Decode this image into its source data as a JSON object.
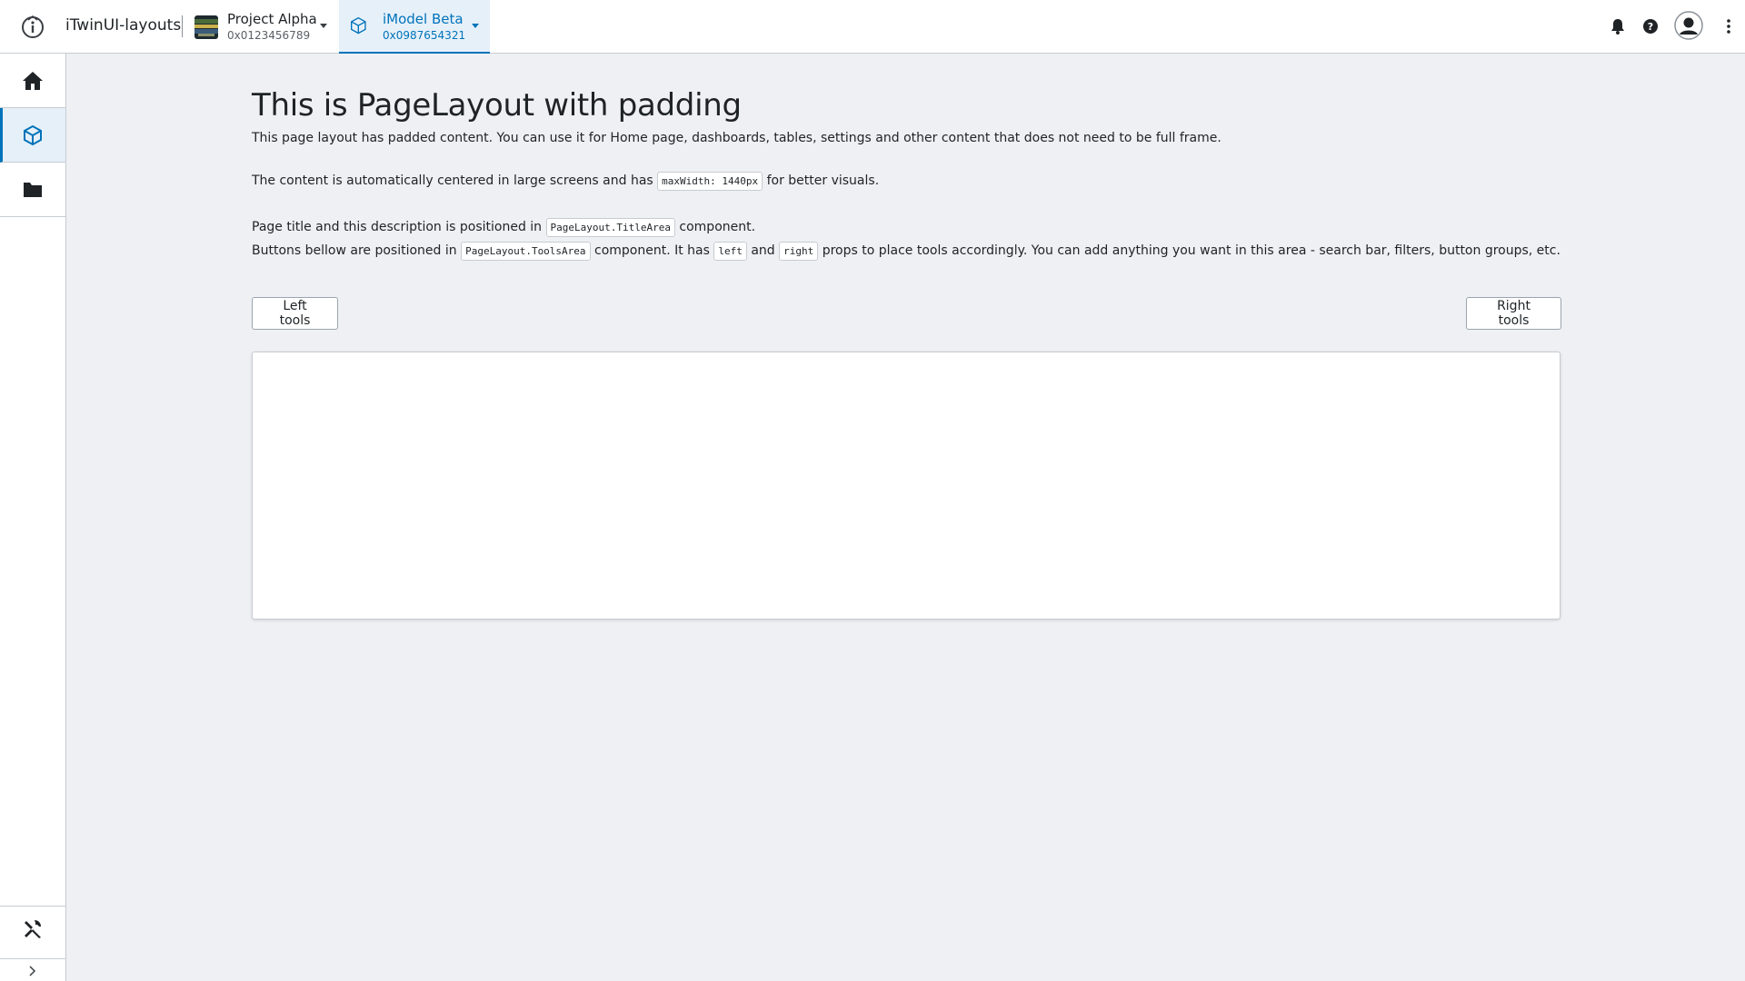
{
  "header": {
    "app_title": "iTwinUI-layouts",
    "project": {
      "name": "Project Alpha",
      "id": "0x0123456789"
    },
    "imodel": {
      "name": "iModel Beta",
      "id": "0x0987654321"
    },
    "icons": [
      "info-logo-icon",
      "bell-icon",
      "help-icon",
      "user-avatar-icon",
      "more-vertical-icon"
    ]
  },
  "sidenav": {
    "items": [
      {
        "icon": "home-icon",
        "active": false
      },
      {
        "icon": "imodel-cube-icon",
        "active": true
      },
      {
        "icon": "folder-icon",
        "active": false
      }
    ],
    "bottom": {
      "icon": "settings-tools-icon"
    },
    "expand": {
      "icon": "chevron-right-icon"
    }
  },
  "page": {
    "title": "This is PageLayout with padding",
    "desc1": "This page layout has padded content. You can use it for Home page, dashboards, tables, settings and other content that does not need to be full frame.",
    "desc2_pre": "The content is automatically centered in large screens and has",
    "desc2_code": "maxWidth: 1440px",
    "desc2_post": "for better visuals.",
    "desc3_pre": "Page title and this description is positioned in",
    "desc3_code": "PageLayout.TitleArea",
    "desc3_post": "component.",
    "desc4_pre": "Buttons bellow are positioned in",
    "desc4_code1": "PageLayout.ToolsArea",
    "desc4_mid1": "component. It has",
    "desc4_code2": "left",
    "desc4_mid2": "and",
    "desc4_code3": "right",
    "desc4_post": "props to place tools accordingly. You can add anything you want in this area - search bar, filters, button groups, etc."
  },
  "tools": {
    "left_label": "Left tools",
    "right_label": "Right tools"
  },
  "colors": {
    "accent": "#0073ba",
    "background": "#eef0f3",
    "surface": "#ffffff",
    "border": "#c7ccd1"
  }
}
